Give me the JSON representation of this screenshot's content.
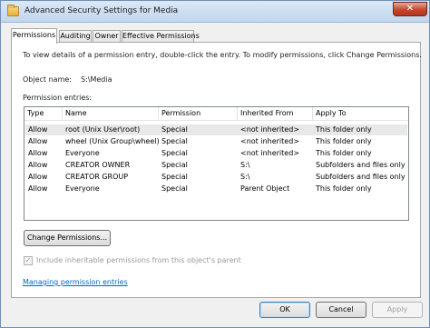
{
  "window": {
    "title": "Advanced Security Settings for Media",
    "close_glyph": "✕"
  },
  "tabs": [
    {
      "label": "Permissions"
    },
    {
      "label": "Auditing"
    },
    {
      "label": "Owner"
    },
    {
      "label": "Effective Permissions"
    }
  ],
  "intro_text": "To view details of a permission entry, double-click the entry. To modify permissions, click Change Permissions.",
  "object": {
    "label": "Object name:",
    "value": "S:\\Media"
  },
  "entries_label": "Permission entries:",
  "columns": [
    "Type",
    "Name",
    "Permission",
    "Inherited From",
    "Apply To"
  ],
  "rows": [
    {
      "type": "Allow",
      "name": "root (Unix User\\root)",
      "permission": "Special",
      "inherited_from": "<not inherited>",
      "apply_to": "This folder only"
    },
    {
      "type": "Allow",
      "name": "wheel (Unix Group\\wheel)",
      "permission": "Special",
      "inherited_from": "<not inherited>",
      "apply_to": "This folder only"
    },
    {
      "type": "Allow",
      "name": "Everyone",
      "permission": "Special",
      "inherited_from": "<not inherited>",
      "apply_to": "This folder only"
    },
    {
      "type": "Allow",
      "name": "CREATOR OWNER",
      "permission": "Special",
      "inherited_from": "S:\\",
      "apply_to": "Subfolders and files only"
    },
    {
      "type": "Allow",
      "name": "CREATOR GROUP",
      "permission": "Special",
      "inherited_from": "S:\\",
      "apply_to": "Subfolders and files only"
    },
    {
      "type": "Allow",
      "name": "Everyone",
      "permission": "Special",
      "inherited_from": "Parent Object",
      "apply_to": "This folder only"
    }
  ],
  "change_button": "Change Permissions...",
  "inherit_checkbox": {
    "label": "Include inheritable permissions from this object's parent",
    "checked": true,
    "glyph": "✓"
  },
  "manage_link": "Managing permission entries",
  "footer": {
    "ok": "OK",
    "cancel": "Cancel",
    "apply": "Apply"
  }
}
